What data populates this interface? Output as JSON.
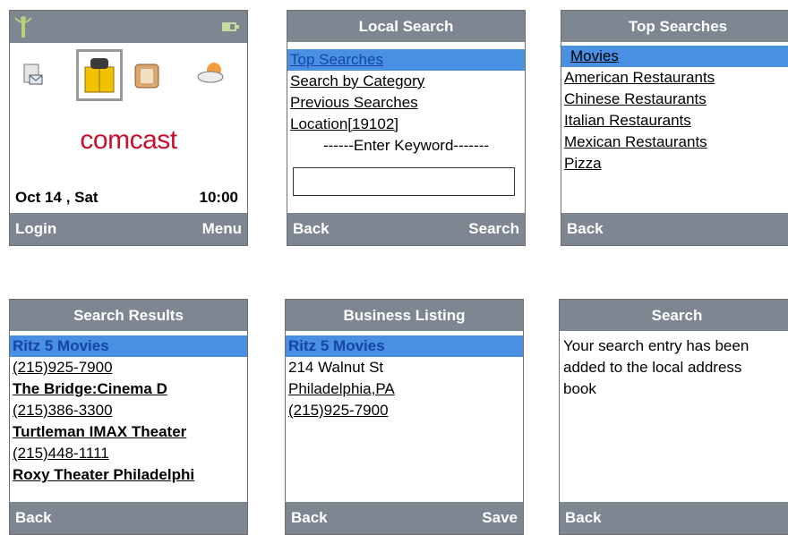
{
  "home": {
    "brand": "comcast",
    "date": "Oct 14 , Sat",
    "time": "10:00",
    "softkey_left": "Login",
    "softkey_right": "Menu"
  },
  "local_search": {
    "title": "Local Search",
    "items": [
      "Top Searches",
      "Search by Category",
      "Previous Searches",
      "Location[19102]"
    ],
    "keyword_label": "------Enter Keyword-------",
    "keyword_value": "",
    "softkey_left": "Back",
    "softkey_right": "Search"
  },
  "top_searches": {
    "title": "Top Searches",
    "items": [
      "Movies",
      "American Restaurants",
      "Chinese Restaurants",
      "Italian Restaurants",
      "Mexican Restaurants",
      "Pizza"
    ],
    "softkey_left": "Back"
  },
  "search_results": {
    "title": "Search Results",
    "results": [
      {
        "name": "Ritz 5 Movies",
        "phone": "(215)925-7900"
      },
      {
        "name": "The Bridge:Cinema D",
        "phone": "(215)386-3300"
      },
      {
        "name": "Turtleman IMAX Theater",
        "phone": "(215)448-1111"
      },
      {
        "name": "Roxy Theater Philadelphi",
        "phone": ""
      }
    ],
    "softkey_left": "Back"
  },
  "business_listing": {
    "title": "Business Listing",
    "name": "Ritz 5 Movies",
    "street": "214 Walnut St",
    "city": "Philadelphia,PA",
    "phone": "(215)925-7900",
    "softkey_left": "Back",
    "softkey_right": "Save"
  },
  "search_confirm": {
    "title": "Search",
    "message": "Your search entry has been added to the local address book",
    "softkey_left": "Back"
  },
  "colors": {
    "bar": "#7d8691",
    "highlight": "#4a90e2",
    "highlight_text": "#1346a6",
    "brand_red": "#c8102e"
  }
}
